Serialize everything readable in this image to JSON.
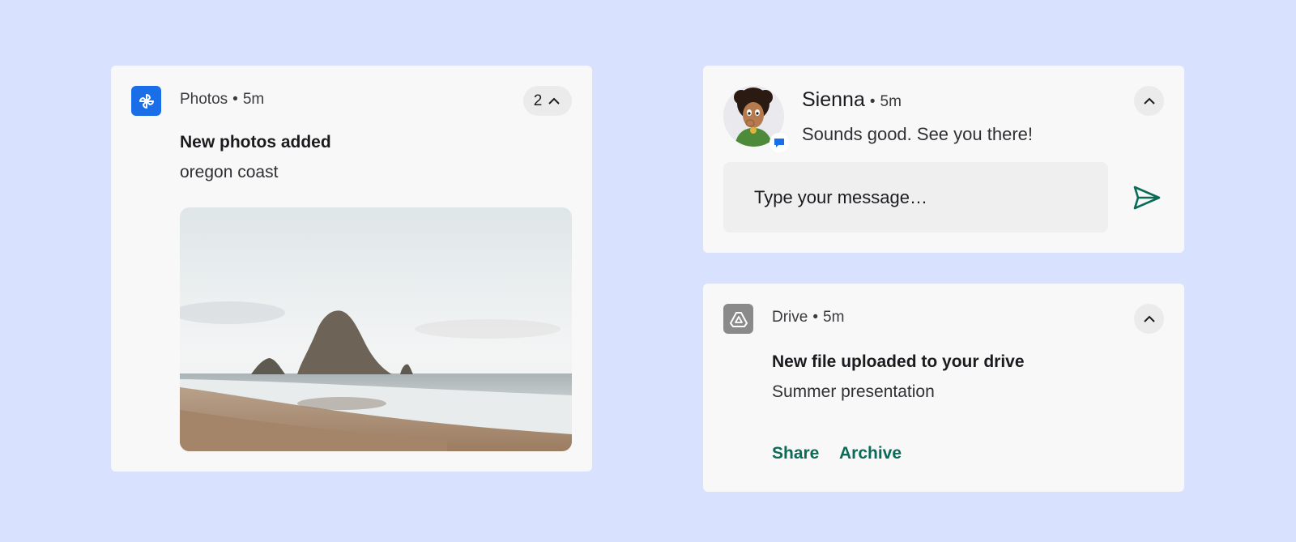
{
  "colors": {
    "background": "#d8e2ff",
    "card": "#f8f8f8",
    "photos_icon": "#1a6fe8",
    "drive_icon": "#8a8a8a",
    "accent_action": "#0a6b57",
    "send_icon": "#0a6b57"
  },
  "photos_notification": {
    "app_icon": "photos-pinwheel-icon",
    "app_name": "Photos",
    "separator": "•",
    "time": "5m",
    "count": "2",
    "expand_icon": "chevron-up-icon",
    "title": "New photos added",
    "text": "oregon coast",
    "image_icon": "coastal-sea-stack-photo"
  },
  "message_notification": {
    "avatar": "sienna-avatar",
    "badge_icon": "messages-bubble-icon",
    "sender": "Sienna",
    "separator": "•",
    "time": "5m",
    "message": "Sounds good. See you there!",
    "expand_icon": "chevron-up-icon",
    "reply_placeholder": "Type your message…",
    "send_icon": "send-arrow-icon"
  },
  "drive_notification": {
    "app_icon": "drive-triangle-icon",
    "app_name": "Drive",
    "separator": "•",
    "time": "5m",
    "expand_icon": "chevron-up-icon",
    "title": "New file uploaded to your drive",
    "text": "Summer presentation",
    "actions": [
      "Share",
      "Archive"
    ]
  }
}
